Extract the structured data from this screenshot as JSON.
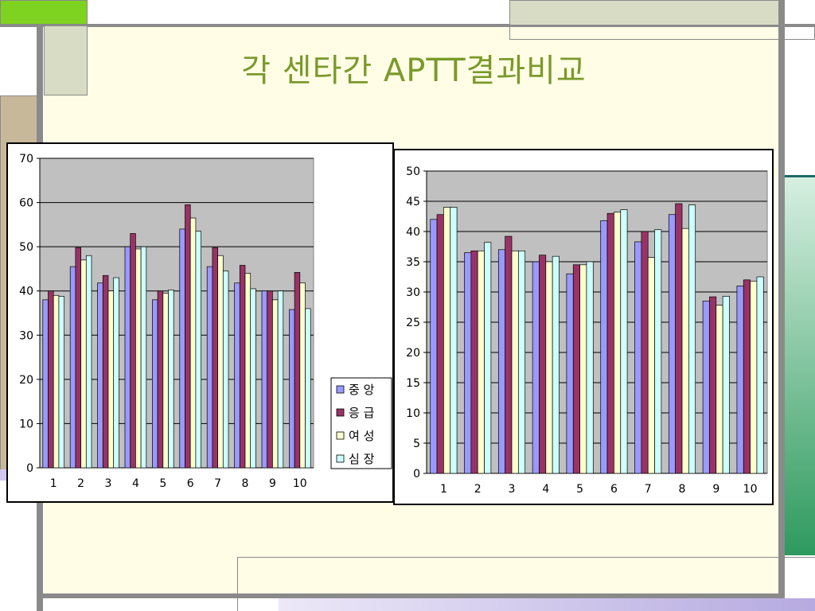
{
  "slide": {
    "title": "각 센타간 APTT결과비교"
  },
  "colors": {
    "background_yellow": "#fffde6",
    "frame_gray": "#8a8a8a",
    "green_accent": "#7ed321",
    "tan_block": "#c8b89a",
    "sage_block": "#d8dcc4",
    "teal_green": "#2e9a5e",
    "lavender": "#d0c8f0"
  },
  "chart_data": [
    {
      "type": "bar",
      "categories": [
        "1",
        "2",
        "3",
        "4",
        "5",
        "6",
        "7",
        "8",
        "9",
        "10"
      ],
      "ylim": [
        0,
        70
      ],
      "yticks": [
        "0",
        "10",
        "20",
        "30",
        "40",
        "50",
        "60",
        "70"
      ],
      "grid": true,
      "legend": "right",
      "series": [
        {
          "name": "중 앙",
          "color": "#9999ff",
          "values": [
            38,
            45.5,
            41.8,
            50,
            38,
            54,
            45.5,
            41.8,
            40,
            35.8
          ]
        },
        {
          "name": "응 급",
          "color": "#993366",
          "values": [
            40,
            49.8,
            43.5,
            53,
            40,
            59.5,
            49.8,
            45.8,
            40,
            44.2
          ]
        },
        {
          "name": "여 성",
          "color": "#ffffcc",
          "values": [
            39,
            47,
            40,
            49.5,
            39.5,
            56.5,
            48,
            44,
            38,
            41.8
          ]
        },
        {
          "name": "심 장",
          "color": "#ccffff",
          "values": [
            38.8,
            48,
            43,
            50,
            40.2,
            53.5,
            44.5,
            40.5,
            40,
            36
          ]
        }
      ]
    },
    {
      "type": "bar",
      "categories": [
        "1",
        "2",
        "3",
        "4",
        "5",
        "6",
        "7",
        "8",
        "9",
        "10"
      ],
      "ylim": [
        0,
        50
      ],
      "yticks": [
        "0",
        "5",
        "10",
        "15",
        "20",
        "25",
        "30",
        "35",
        "40",
        "45",
        "50"
      ],
      "grid": true,
      "series": [
        {
          "color": "#9999ff",
          "values": [
            42,
            36.5,
            37,
            35,
            33,
            41.8,
            38.3,
            42.8,
            28.5,
            31
          ]
        },
        {
          "color": "#993366",
          "values": [
            42.8,
            36.8,
            39.2,
            36.1,
            34.5,
            43,
            40,
            44.6,
            29.2,
            32
          ]
        },
        {
          "color": "#ffffcc",
          "values": [
            44,
            36.8,
            36.8,
            35,
            34.5,
            43.2,
            35.7,
            40.5,
            27.8,
            31.8
          ]
        },
        {
          "color": "#ccffff",
          "values": [
            44,
            38.2,
            36.8,
            35.9,
            35,
            43.6,
            40.3,
            44.4,
            29.3,
            32.5
          ]
        }
      ]
    }
  ]
}
